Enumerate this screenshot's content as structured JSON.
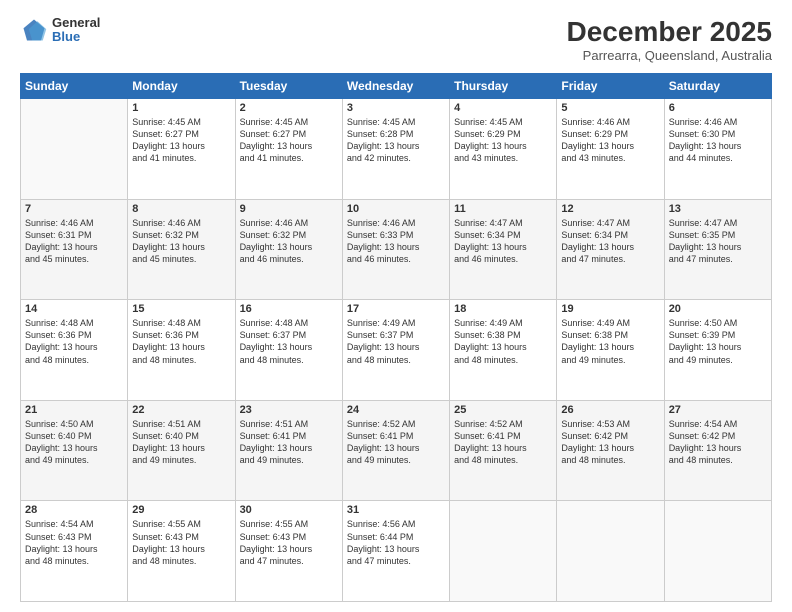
{
  "header": {
    "logo": {
      "general": "General",
      "blue": "Blue"
    },
    "title": "December 2025",
    "subtitle": "Parrearra, Queensland, Australia"
  },
  "weekdays": [
    "Sunday",
    "Monday",
    "Tuesday",
    "Wednesday",
    "Thursday",
    "Friday",
    "Saturday"
  ],
  "weeks": [
    [
      {
        "day": "",
        "text": ""
      },
      {
        "day": "1",
        "text": "Sunrise: 4:45 AM\nSunset: 6:27 PM\nDaylight: 13 hours\nand 41 minutes."
      },
      {
        "day": "2",
        "text": "Sunrise: 4:45 AM\nSunset: 6:27 PM\nDaylight: 13 hours\nand 41 minutes."
      },
      {
        "day": "3",
        "text": "Sunrise: 4:45 AM\nSunset: 6:28 PM\nDaylight: 13 hours\nand 42 minutes."
      },
      {
        "day": "4",
        "text": "Sunrise: 4:45 AM\nSunset: 6:29 PM\nDaylight: 13 hours\nand 43 minutes."
      },
      {
        "day": "5",
        "text": "Sunrise: 4:46 AM\nSunset: 6:29 PM\nDaylight: 13 hours\nand 43 minutes."
      },
      {
        "day": "6",
        "text": "Sunrise: 4:46 AM\nSunset: 6:30 PM\nDaylight: 13 hours\nand 44 minutes."
      }
    ],
    [
      {
        "day": "7",
        "text": "Sunrise: 4:46 AM\nSunset: 6:31 PM\nDaylight: 13 hours\nand 45 minutes."
      },
      {
        "day": "8",
        "text": "Sunrise: 4:46 AM\nSunset: 6:32 PM\nDaylight: 13 hours\nand 45 minutes."
      },
      {
        "day": "9",
        "text": "Sunrise: 4:46 AM\nSunset: 6:32 PM\nDaylight: 13 hours\nand 46 minutes."
      },
      {
        "day": "10",
        "text": "Sunrise: 4:46 AM\nSunset: 6:33 PM\nDaylight: 13 hours\nand 46 minutes."
      },
      {
        "day": "11",
        "text": "Sunrise: 4:47 AM\nSunset: 6:34 PM\nDaylight: 13 hours\nand 46 minutes."
      },
      {
        "day": "12",
        "text": "Sunrise: 4:47 AM\nSunset: 6:34 PM\nDaylight: 13 hours\nand 47 minutes."
      },
      {
        "day": "13",
        "text": "Sunrise: 4:47 AM\nSunset: 6:35 PM\nDaylight: 13 hours\nand 47 minutes."
      }
    ],
    [
      {
        "day": "14",
        "text": "Sunrise: 4:48 AM\nSunset: 6:36 PM\nDaylight: 13 hours\nand 48 minutes."
      },
      {
        "day": "15",
        "text": "Sunrise: 4:48 AM\nSunset: 6:36 PM\nDaylight: 13 hours\nand 48 minutes."
      },
      {
        "day": "16",
        "text": "Sunrise: 4:48 AM\nSunset: 6:37 PM\nDaylight: 13 hours\nand 48 minutes."
      },
      {
        "day": "17",
        "text": "Sunrise: 4:49 AM\nSunset: 6:37 PM\nDaylight: 13 hours\nand 48 minutes."
      },
      {
        "day": "18",
        "text": "Sunrise: 4:49 AM\nSunset: 6:38 PM\nDaylight: 13 hours\nand 48 minutes."
      },
      {
        "day": "19",
        "text": "Sunrise: 4:49 AM\nSunset: 6:38 PM\nDaylight: 13 hours\nand 49 minutes."
      },
      {
        "day": "20",
        "text": "Sunrise: 4:50 AM\nSunset: 6:39 PM\nDaylight: 13 hours\nand 49 minutes."
      }
    ],
    [
      {
        "day": "21",
        "text": "Sunrise: 4:50 AM\nSunset: 6:40 PM\nDaylight: 13 hours\nand 49 minutes."
      },
      {
        "day": "22",
        "text": "Sunrise: 4:51 AM\nSunset: 6:40 PM\nDaylight: 13 hours\nand 49 minutes."
      },
      {
        "day": "23",
        "text": "Sunrise: 4:51 AM\nSunset: 6:41 PM\nDaylight: 13 hours\nand 49 minutes."
      },
      {
        "day": "24",
        "text": "Sunrise: 4:52 AM\nSunset: 6:41 PM\nDaylight: 13 hours\nand 49 minutes."
      },
      {
        "day": "25",
        "text": "Sunrise: 4:52 AM\nSunset: 6:41 PM\nDaylight: 13 hours\nand 48 minutes."
      },
      {
        "day": "26",
        "text": "Sunrise: 4:53 AM\nSunset: 6:42 PM\nDaylight: 13 hours\nand 48 minutes."
      },
      {
        "day": "27",
        "text": "Sunrise: 4:54 AM\nSunset: 6:42 PM\nDaylight: 13 hours\nand 48 minutes."
      }
    ],
    [
      {
        "day": "28",
        "text": "Sunrise: 4:54 AM\nSunset: 6:43 PM\nDaylight: 13 hours\nand 48 minutes."
      },
      {
        "day": "29",
        "text": "Sunrise: 4:55 AM\nSunset: 6:43 PM\nDaylight: 13 hours\nand 48 minutes."
      },
      {
        "day": "30",
        "text": "Sunrise: 4:55 AM\nSunset: 6:43 PM\nDaylight: 13 hours\nand 47 minutes."
      },
      {
        "day": "31",
        "text": "Sunrise: 4:56 AM\nSunset: 6:44 PM\nDaylight: 13 hours\nand 47 minutes."
      },
      {
        "day": "",
        "text": ""
      },
      {
        "day": "",
        "text": ""
      },
      {
        "day": "",
        "text": ""
      }
    ]
  ]
}
